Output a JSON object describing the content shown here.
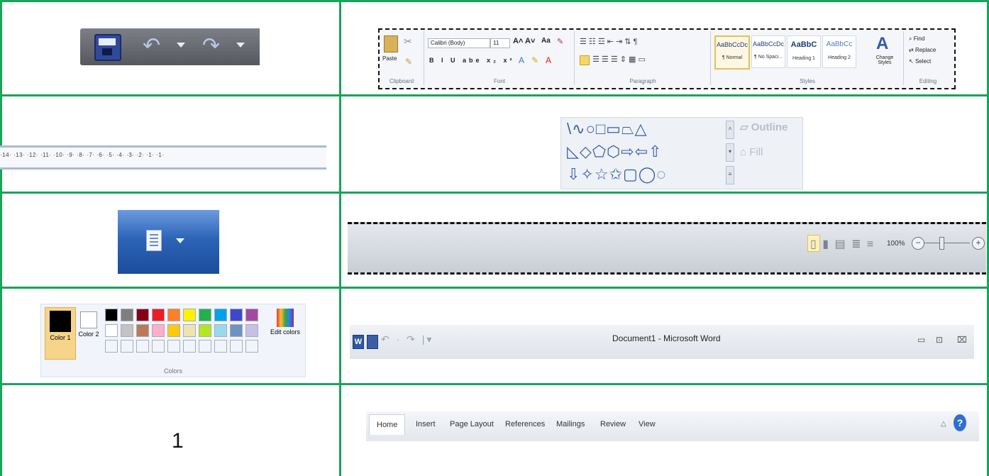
{
  "rows": [
    "quick-access-toolbar",
    "ruler-and-shapes",
    "view-and-statusbar",
    "colors-and-titlebar",
    "numeral-and-tabs"
  ],
  "ribbon": {
    "clipboard": {
      "paste": "Paste",
      "label": "Clipboard"
    },
    "font": {
      "name": "Calibri (Body)",
      "size": "11",
      "label": "Font",
      "format_buttons": "B I U abe x₂ x²"
    },
    "paragraph": {
      "label": "Paragraph"
    },
    "styles": {
      "label": "Styles",
      "items": [
        {
          "preview": "AaBbCcDc",
          "name": "¶ Normal"
        },
        {
          "preview": "AaBbCcDc",
          "name": "¶ No Spaci..."
        },
        {
          "preview": "AaBbC",
          "name": "Heading 1"
        },
        {
          "preview": "AaBbCc",
          "name": "Heading 2"
        }
      ],
      "change": "Change Styles"
    },
    "editing": {
      "find": "Find",
      "replace": "Replace",
      "select": "Select",
      "label": "Editing"
    }
  },
  "ruler": {
    "marks": "·14· ·13· ·12· ·11· ·10· ·9· ·8· ·7· ·6· ·5· ·4· ·3· ·2· ·1· ·1·"
  },
  "shapes": {
    "row1": "\\∿○□▭⏢△",
    "row2": "◺◇⬠⬡⇨⇦⇧",
    "row3": "⇩✧☆✩▢◯◌",
    "outline_label": "Outline",
    "fill_label": "Fill"
  },
  "statusbar": {
    "zoom": "100%"
  },
  "colors_panel": {
    "color1_label": "Color 1",
    "color2_label": "Color 2",
    "edit_label": "Edit colors",
    "group_label": "Colors",
    "palette_row1": [
      "#000000",
      "#7f7f7f",
      "#880015",
      "#ed1c24",
      "#ff7f27",
      "#fff200",
      "#22b14c",
      "#00a2e8",
      "#3f48cc",
      "#a349a4"
    ],
    "palette_row2": [
      "#ffffff",
      "#c3c3c3",
      "#b97a57",
      "#ffaec9",
      "#ffc90e",
      "#efe4b0",
      "#b5e61d",
      "#99d9ea",
      "#7092be",
      "#c8bfe7"
    ]
  },
  "titlebar": {
    "title": "Document1 - Microsoft Word",
    "word_glyph": "W",
    "qat": "↶ · ↷ |▾",
    "min": "▭",
    "max": "⊡",
    "close": "⌧"
  },
  "tabs": [
    "Home",
    "Insert",
    "Page Layout",
    "References",
    "Mailings",
    "Review",
    "View"
  ],
  "help": "?",
  "numeral": "1",
  "colors": {
    "border": "#1aa35a"
  }
}
